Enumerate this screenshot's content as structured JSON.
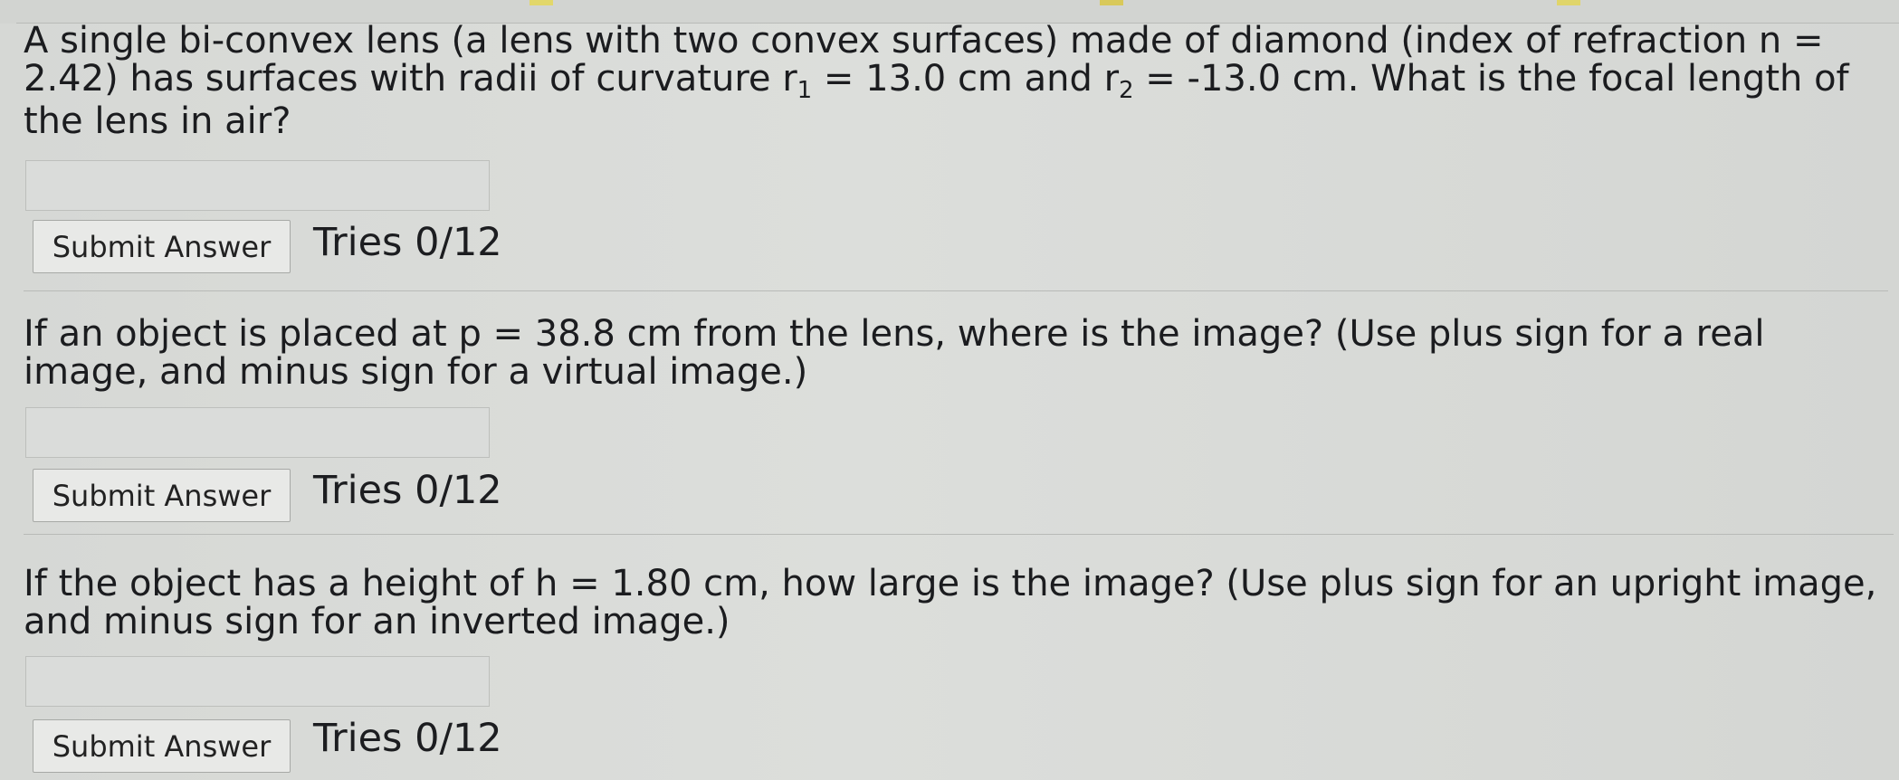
{
  "questions": [
    {
      "text_before_r1": "A single bi-convex lens (a lens with two convex surfaces) made of diamond (index of refraction n = 2.42) has surfaces with radii of curvature r",
      "r1_subscript": "1",
      "text_between": " = 13.0 cm and r",
      "r2_subscript": "2",
      "text_after_r2": " = -13.0 cm. What is the focal length of the lens in air?",
      "submit_label": "Submit Answer",
      "tries": "Tries 0/12"
    },
    {
      "text": "If an object is placed at p = 38.8 cm from the lens, where is the image? (Use plus sign for a real image, and minus sign for a virtual image.)",
      "submit_label": "Submit Answer",
      "tries": "Tries 0/12"
    },
    {
      "text": "If the object has a height of h = 1.80 cm, how large is the image? (Use plus sign for an upright image, and minus sign for an inverted image.)",
      "submit_label": "Submit Answer",
      "tries": "Tries 0/12"
    }
  ]
}
